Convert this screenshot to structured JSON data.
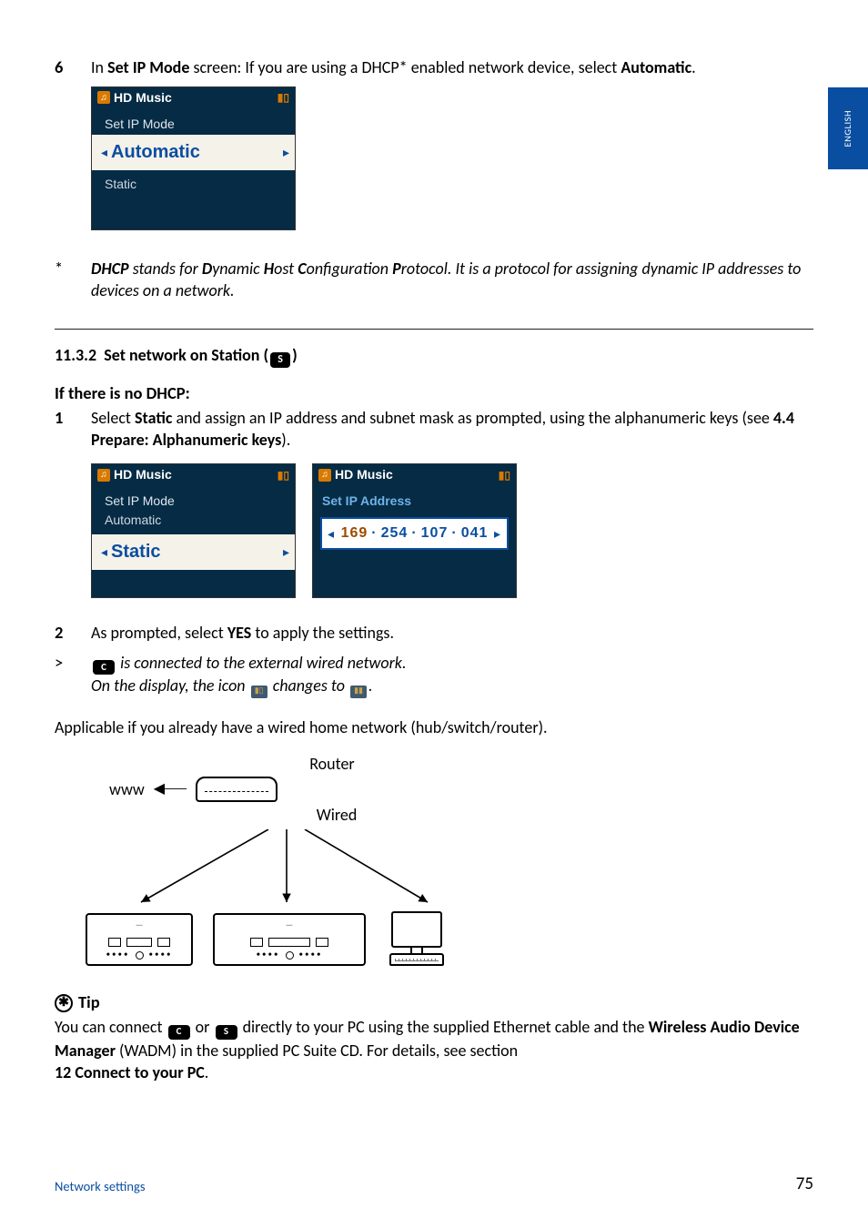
{
  "sideTab": "ENGLISH",
  "step6": {
    "num": "6",
    "text_a": "In ",
    "bold_a": "Set IP Mode",
    "text_b": " screen: If you are using a DHCP* enabled network device, select ",
    "bold_b": "Automatic",
    "text_c": "."
  },
  "device1": {
    "title": "HD Music",
    "sub": "Set IP Mode",
    "selected": "Automatic",
    "other": "Static"
  },
  "dhcpNote": {
    "ast": "*",
    "b1": "DHCP",
    "t1": " stands for ",
    "b2": "D",
    "t2": "ynamic ",
    "b3": "H",
    "t3": "ost ",
    "b4": "C",
    "t4": "onfiguration ",
    "b5": "P",
    "t5": "rotocol. It is a protocol for assigning dynamic IP addresses to devices on a network."
  },
  "subhead": {
    "num": "11.3.2",
    "title": "Set network on Station (",
    "badge": "S",
    "close": ")"
  },
  "ifLine": "If there is no DHCP:",
  "step1": {
    "num": "1",
    "t1": "Select ",
    "b1": "Static",
    "t2": " and assign an IP address and subnet mask as prompted, using the alphanumeric keys (see ",
    "b2": "4.4 Prepare: Alphanumeric keys",
    "t3": ")."
  },
  "deviceStatic": {
    "title": "HD Music",
    "sub": "Set IP Mode",
    "other": "Automatic",
    "selected": "Static"
  },
  "deviceIP": {
    "title": "HD Music",
    "sub": "Set IP Address",
    "oct1": "169",
    "oct2": "254",
    "oct3": "107",
    "oct4": "041"
  },
  "step2": {
    "num": "2",
    "t1": "As prompted, select ",
    "b1": "YES",
    "t2": " to apply the settings."
  },
  "result": {
    "marker": ">",
    "badge": "C",
    "t1": " is connected to the external wired network.",
    "t2": "On the display, the icon ",
    "t3": " changes to ",
    "t4": "."
  },
  "applicable": "Applicable if you already have a wired home network (hub/switch/router).",
  "diagram": {
    "router": "Router",
    "www": "www",
    "wired": "Wired"
  },
  "tip": {
    "head": "Tip",
    "t1": "You can connect ",
    "b1": "C",
    "t2": " or ",
    "b2": "S",
    "t3": " directly to your PC using the supplied Ethernet cable and the ",
    "bold1": "Wireless Audio Device Manager",
    "t4": " (WADM) in the supplied PC Suite CD. For details, see section ",
    "bold2": "12 Connect to your PC",
    "t5": "."
  },
  "footer": {
    "section": "Network settings",
    "page": "75"
  }
}
